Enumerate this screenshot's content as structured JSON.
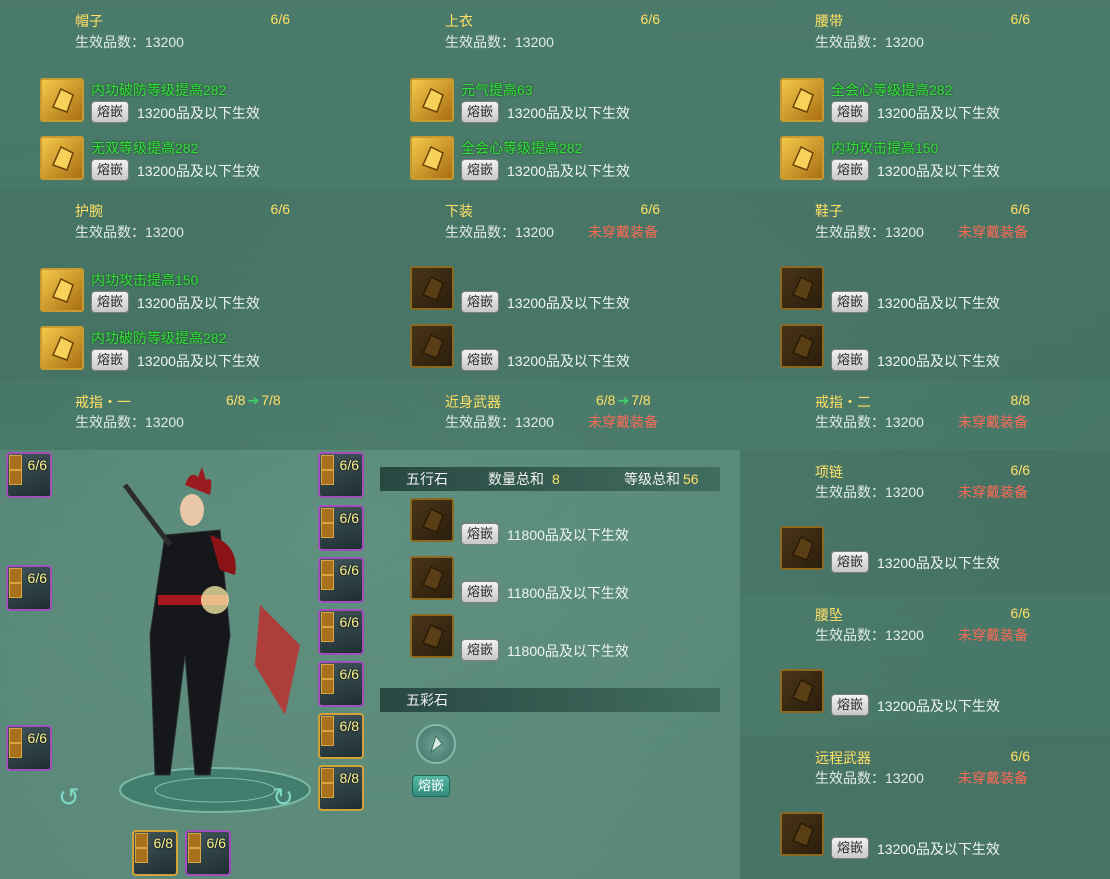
{
  "labels": {
    "effective_prefix": "生效品数：13200",
    "unequipped": "未穿戴装备",
    "fuse": "熔嵌"
  },
  "slots": {
    "hat": {
      "name": "帽子",
      "count": "6/6",
      "gems": [
        {
          "desc": "内功破防等级提高282",
          "note": "13200品及以下生效"
        },
        {
          "desc": "无双等级提高282",
          "note": "13200品及以下生效"
        }
      ]
    },
    "top": {
      "name": "上衣",
      "count": "6/6",
      "gems": [
        {
          "desc": "元气提高63",
          "note": "13200品及以下生效"
        },
        {
          "desc": "全会心等级提高282",
          "note": "13200品及以下生效"
        }
      ]
    },
    "belt": {
      "name": "腰带",
      "count": "6/6",
      "gems": [
        {
          "desc": "全会心等级提高282",
          "note": "13200品及以下生效"
        },
        {
          "desc": "内功攻击提高150",
          "note": "13200品及以下生效"
        }
      ]
    },
    "bracer": {
      "name": "护腕",
      "count": "6/6",
      "gems": [
        {
          "desc": "内功攻击提高150",
          "note": "13200品及以下生效"
        },
        {
          "desc": "内功破防等级提高282",
          "note": "13200品及以下生效"
        }
      ]
    },
    "pants": {
      "name": "下装",
      "count": "6/6",
      "gems": [
        {
          "note": "13200品及以下生效"
        },
        {
          "note": "13200品及以下生效"
        }
      ]
    },
    "shoes": {
      "name": "鞋子",
      "count": "6/6",
      "gems": [
        {
          "note": "13200品及以下生效"
        },
        {
          "note": "13200品及以下生效"
        }
      ]
    },
    "ring1": {
      "name": "戒指・一",
      "count": "6/8",
      "upgrade": "7/8"
    },
    "melee": {
      "name": "近身武器",
      "count": "6/8",
      "upgrade": "7/8"
    },
    "ring2": {
      "name": "戒指・二",
      "count": "8/8"
    },
    "necklace": {
      "name": "项链",
      "count": "6/6",
      "gems": [
        {
          "note": "13200品及以下生效"
        }
      ]
    },
    "pendant": {
      "name": "腰坠",
      "count": "6/6",
      "gems": [
        {
          "note": "13200品及以下生效"
        }
      ]
    },
    "ranged": {
      "name": "远程武器",
      "count": "6/6",
      "gems": [
        {
          "note": "13200品及以下生效"
        }
      ]
    }
  },
  "wuxing": {
    "title": "五行石",
    "qty_label": "数量总和",
    "qty": "8",
    "lvl_label": "等级总和",
    "lvl": "56",
    "notes": [
      "11800品及以下生效",
      "11800品及以下生效",
      "11800品及以下生效"
    ]
  },
  "wucai": {
    "title": "五彩石"
  },
  "char_slots": {
    "left": [
      "6/6",
      "6/6",
      "6/6"
    ],
    "right": [
      "6/6",
      "6/6",
      "6/6",
      "6/6",
      "6/6",
      "6/8",
      "8/8"
    ],
    "bottom": [
      "6/8",
      "6/6"
    ]
  },
  "colors": {
    "gem_active": "#35e03c",
    "slot_name": "#ffe066",
    "unequipped": "#ff6a55",
    "upgrade_arrow": "#3fd16a"
  }
}
